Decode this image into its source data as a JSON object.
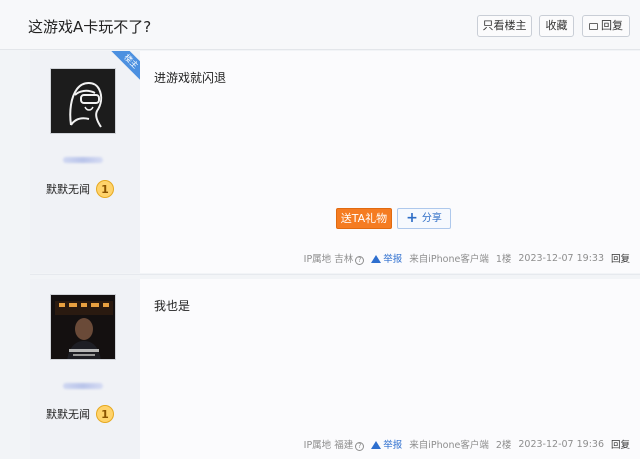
{
  "thread": {
    "title": "这游戏A卡玩不了?",
    "only_op_label": "只看楼主",
    "favorite_label": "收藏",
    "reply_label": "回复"
  },
  "posts": [
    {
      "badge": "楼主",
      "user_tag": "默默无闻",
      "level": "1",
      "content": "进游戏就闪退",
      "gift_label": "送TA礼物",
      "share_label": "分享",
      "ip_label": "IP属地",
      "ip_location": "吉林",
      "report_label": "举报",
      "source": "来自iPhone客户端",
      "floor": "1楼",
      "time": "2023-12-07 19:33",
      "reply_label": "回复"
    },
    {
      "user_tag": "默默无闻",
      "level": "1",
      "content": "我也是",
      "ip_label": "IP属地",
      "ip_location": "福建",
      "report_label": "举报",
      "source": "来自iPhone客户端",
      "floor": "2楼",
      "time": "2023-12-07 19:36",
      "reply_label": "回复"
    }
  ],
  "colors": {
    "gift_button": "#f57c22",
    "link_blue": "#2e6fcf",
    "op_badge": "#4c90e0",
    "level_badge": "#ffd36b"
  },
  "icons": [
    "reply-icon",
    "help-icon",
    "warning-icon",
    "plus-icon",
    "level-badge-icon"
  ]
}
